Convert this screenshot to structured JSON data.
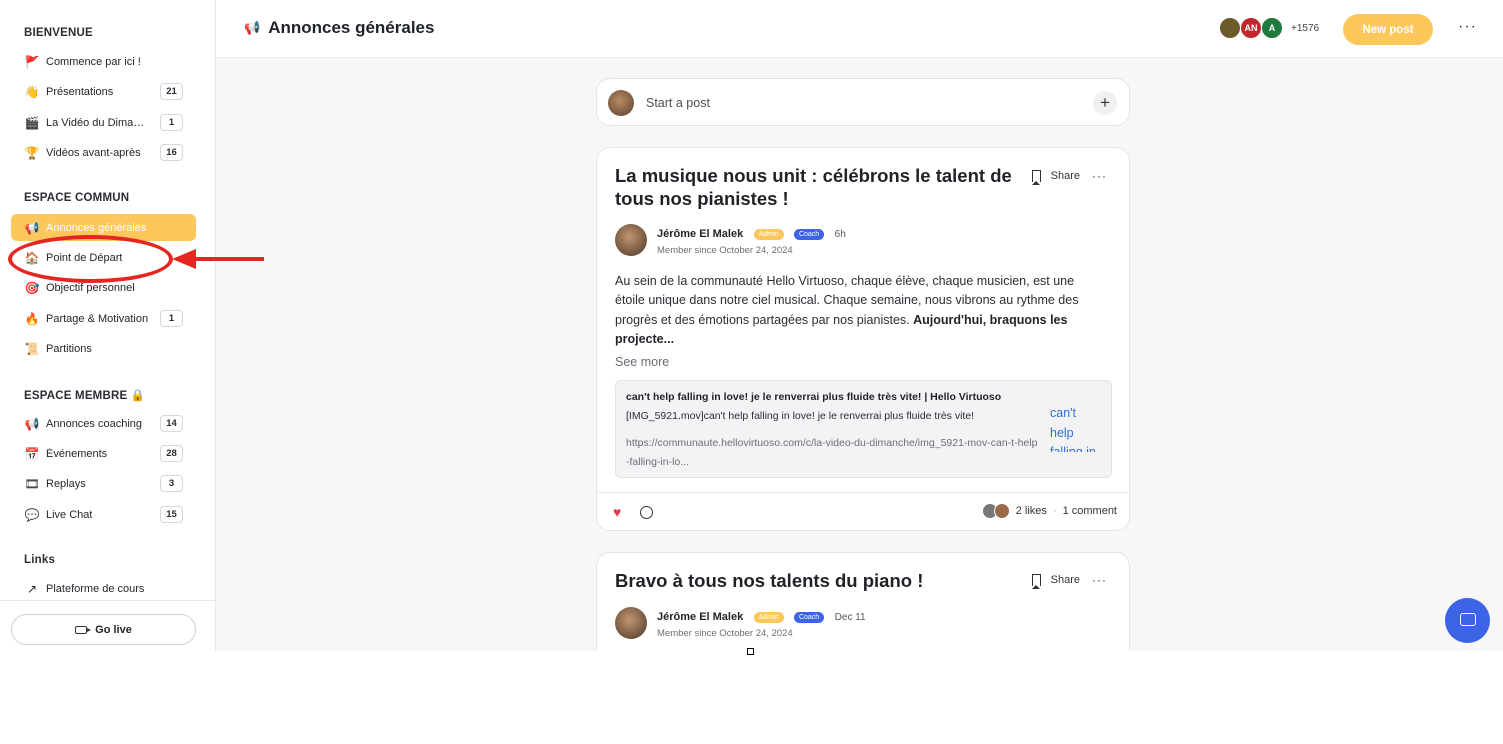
{
  "sidebar": {
    "sections": [
      {
        "title": "BIENVENUE"
      },
      {
        "title": "ESPACE COMMUN"
      },
      {
        "title": "ESPACE MEMBRE 🔒"
      },
      {
        "title": "Links"
      }
    ],
    "items": [
      {
        "icon": "🚩",
        "label": "Commence par ici !",
        "count": ""
      },
      {
        "icon": "👋",
        "label": "Présentations",
        "count": "21"
      },
      {
        "icon": "🎬",
        "label": "La Vidéo du Dimanche",
        "count": "1"
      },
      {
        "icon": "🏆",
        "label": "Vidéos avant-après",
        "count": "16"
      },
      {
        "icon": "📢",
        "label": "Annonces générales",
        "count": ""
      },
      {
        "icon": "🏠",
        "label": "Point de Départ",
        "count": ""
      },
      {
        "icon": "🎯",
        "label": "Objectif personnel",
        "count": ""
      },
      {
        "icon": "🔥",
        "label": "Partage & Motivation",
        "count": "1"
      },
      {
        "icon": "📜",
        "label": "Partitions",
        "count": ""
      },
      {
        "icon": "📢",
        "label": "Annonces coaching",
        "count": "14"
      },
      {
        "icon": "📅",
        "label": "Événements",
        "count": "28"
      },
      {
        "icon": "🎞",
        "label": "Replays",
        "count": "3"
      },
      {
        "icon": "💬",
        "label": "Live Chat",
        "count": "15"
      },
      {
        "icon": "↗",
        "label": "Plateforme de cours",
        "count": ""
      }
    ],
    "go_live": "Go live"
  },
  "header": {
    "title": "Annonces générales",
    "icon": "📢",
    "avatars": [
      {
        "initials": "",
        "color": "#6b5a2a"
      },
      {
        "initials": "AN",
        "color": "#c0282d"
      },
      {
        "initials": "A",
        "color": "#1e7a3d"
      }
    ],
    "member_count": "+1576",
    "new_post": "New post",
    "more": "···"
  },
  "composer": {
    "placeholder": "Start a post",
    "plus": "+"
  },
  "posts": [
    {
      "title": "La musique nous unit : célébrons le talent de tous nos pianistes !",
      "share": "Share",
      "more": "···",
      "author": "Jérôme El Malek",
      "badge_admin": "Admin",
      "badge_coach": "Coach",
      "time": "6h",
      "since": "Member since October 24, 2024",
      "body": "Au sein de la communauté Hello Virtuoso, chaque élève, chaque musicien, est une étoile unique dans notre ciel musical. Chaque semaine, nous vibrons au rythme des progrès et des émotions partagées par nos pianistes. ",
      "body_bold": "Aujourd'hui, braquons les projecte...",
      "see_more": "See more",
      "embed": {
        "title": "can't help falling in love! je le renverrai plus fluide très vite! | Hello Virtuoso",
        "desc": "[IMG_5921.mov]can't help falling in love! je le renverrai plus fluide très vite!",
        "url": "https://communaute.hellovirtuoso.com/c/la-video-du-dimanche/img_5921-mov-can-t-help-falling-in-lo...",
        "img_alt": "can't help falling in lo"
      },
      "likes": "2 likes",
      "sep": "·",
      "comments": "1 comment",
      "heart": "♥"
    },
    {
      "title": "Bravo à tous nos talents du piano !",
      "share": "Share",
      "more": "···",
      "author": "Jérôme El Malek",
      "badge_admin": "Admin",
      "badge_coach": "Coach",
      "time": "Dec 11",
      "since": "Member since October 24, 2024"
    }
  ],
  "colors": {
    "accent": "#fdc75c",
    "coach_badge": "#3d63e6",
    "annotation": "#e52520",
    "heart": "#e43b4c"
  }
}
